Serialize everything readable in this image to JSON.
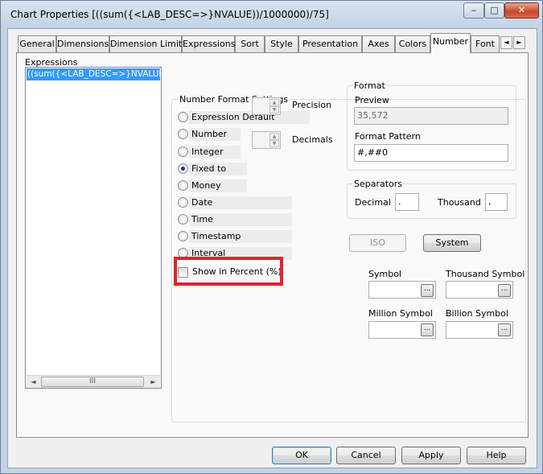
{
  "window": {
    "title": "Chart Properties [((sum({<LAB_DESC=>}NVALUE))/1000000)/75]",
    "minimize_glyph": "‒",
    "maximize_glyph": "□",
    "close_glyph": "✕"
  },
  "tabs": [
    {
      "label": "General"
    },
    {
      "label": "Dimensions"
    },
    {
      "label": "Dimension Limits"
    },
    {
      "label": "Expressions"
    },
    {
      "label": "Sort"
    },
    {
      "label": "Style"
    },
    {
      "label": "Presentation"
    },
    {
      "label": "Axes"
    },
    {
      "label": "Colors"
    },
    {
      "label": "Number"
    },
    {
      "label": "Font"
    }
  ],
  "active_tab": "Number",
  "tab_scroll": {
    "left": "◄",
    "right": "►"
  },
  "expressions": {
    "label": "Expressions",
    "items": [
      "((sum({<LAB_DESC=>}NVALUE))/"
    ],
    "scroll_left": "◄",
    "scroll_right": "►",
    "scroll_thumb": "III"
  },
  "number_format": {
    "group_label": "Number Format Settings",
    "options": [
      {
        "label": "Expression Default",
        "selected": false
      },
      {
        "label": "Number",
        "selected": false
      },
      {
        "label": "Integer",
        "selected": false
      },
      {
        "label": "Fixed to",
        "selected": true
      },
      {
        "label": "Money",
        "selected": false
      },
      {
        "label": "Date",
        "selected": false
      },
      {
        "label": "Time",
        "selected": false
      },
      {
        "label": "Timestamp",
        "selected": false
      },
      {
        "label": "Interval",
        "selected": false
      }
    ],
    "precision_label": "Precision",
    "decimals_label": "Decimals",
    "spin_up": "▲",
    "spin_down": "▼",
    "show_in_percent_label": "Show in Percent (%)",
    "show_in_percent_checked": false,
    "highlight_color": "#e3232c"
  },
  "format": {
    "group_label": "Format",
    "preview_label": "Preview",
    "preview_value": "35,572",
    "pattern_label": "Format Pattern",
    "pattern_value": "#,##0"
  },
  "separators": {
    "group_label": "Separators",
    "decimal_label": "Decimal",
    "decimal_value": ".",
    "thousand_label": "Thousand",
    "thousand_value": ","
  },
  "buttons": {
    "iso": "ISO",
    "system": "System",
    "ok": "OK",
    "cancel": "Cancel",
    "apply": "Apply",
    "help": "Help"
  },
  "symbols": {
    "symbol_label": "Symbol",
    "thousand_symbol_label": "Thousand Symbol",
    "million_symbol_label": "Million Symbol",
    "billion_symbol_label": "Billion Symbol",
    "browse_glyph": "..."
  }
}
